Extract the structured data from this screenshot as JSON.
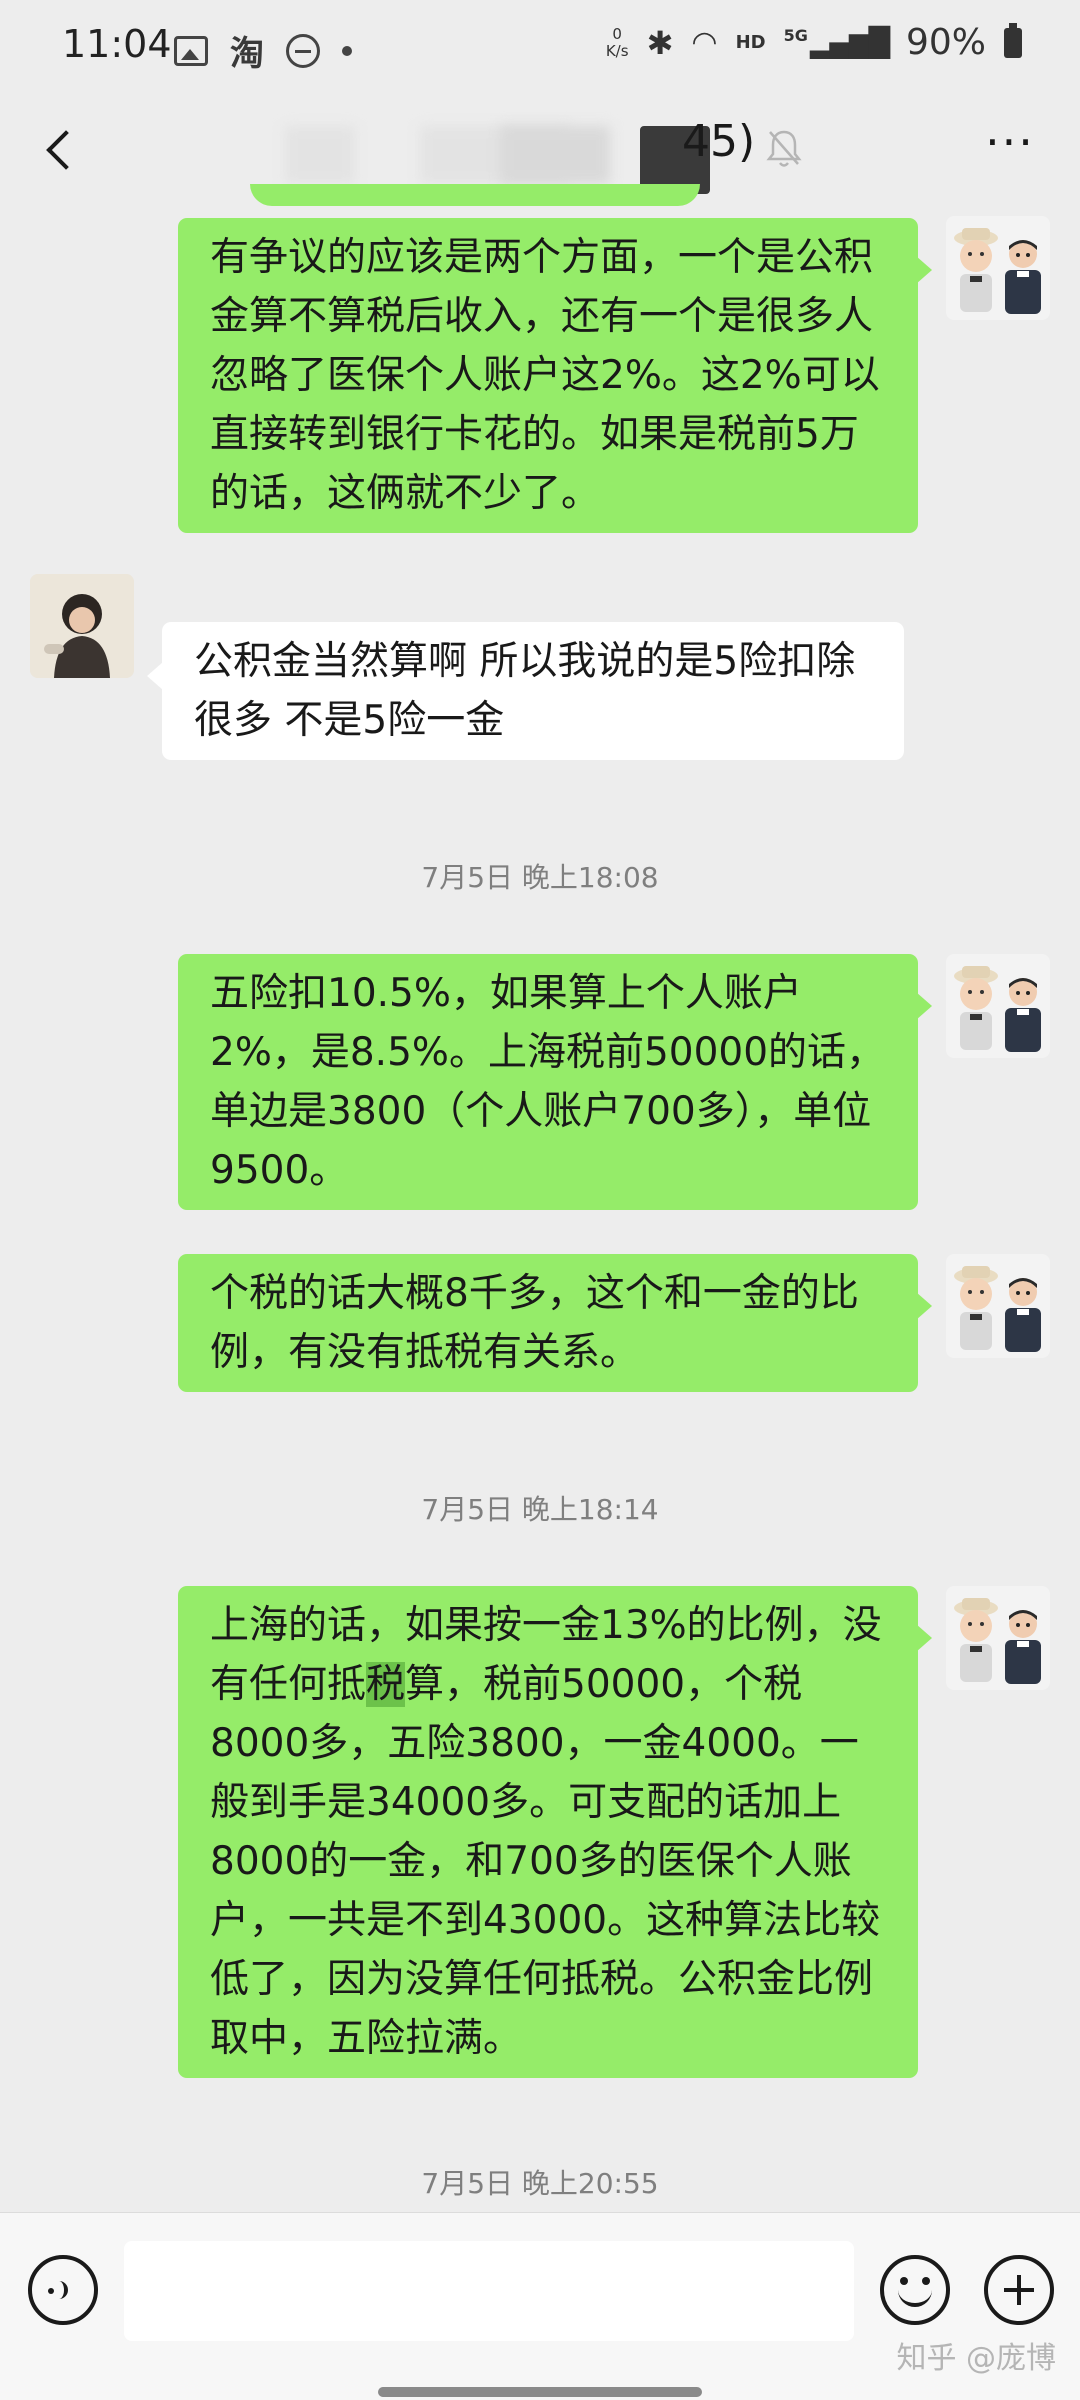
{
  "status_bar": {
    "time": "11:04",
    "app_icon": "淘",
    "speed_top": "0",
    "speed_unit": "K/s",
    "hd": "HD",
    "network": "5G",
    "battery": "90%"
  },
  "nav": {
    "title_suffix": "45)",
    "more": "···"
  },
  "messages": [
    {
      "side": "me",
      "text": "有争议的应该是两个方面，一个是公积金算不算税后收入，还有一个是很多人忽略了医保个人账户这2%。这2%可以直接转到银行卡花的。如果是税前5万的话，这俩就不少了。"
    },
    {
      "side": "other",
      "text": "公积金当然算啊 所以我说的是5险扣除很多 不是5险一金"
    },
    {
      "timestamp": "7月5日 晚上18:08"
    },
    {
      "side": "me",
      "text": "五险扣10.5%，如果算上个人账户2%，是8.5%。上海税前50000的话，单边是3800（个人账户700多），单位9500。"
    },
    {
      "side": "me",
      "text": "个税的话大概8千多，这个和一金的比例，有没有抵税有关系。"
    },
    {
      "timestamp": "7月5日 晚上18:14"
    },
    {
      "side": "me",
      "text_before_highlight": "上海的话，如果按一金13%的比例，没有任何抵",
      "highlight": "税",
      "text_after_highlight": "算，税前50000，个税8000多，五险3800，一金4000。一般到手是34000多。可支配的话加上8000的一金，和700多的医保个人账户，一共是不到43000。这种算法比较低了，因为没算任何抵税。公积金比例取中，五险拉满。"
    },
    {
      "timestamp": "7月5日 晚上20:55"
    }
  ],
  "watermark": "知乎 @庞博"
}
